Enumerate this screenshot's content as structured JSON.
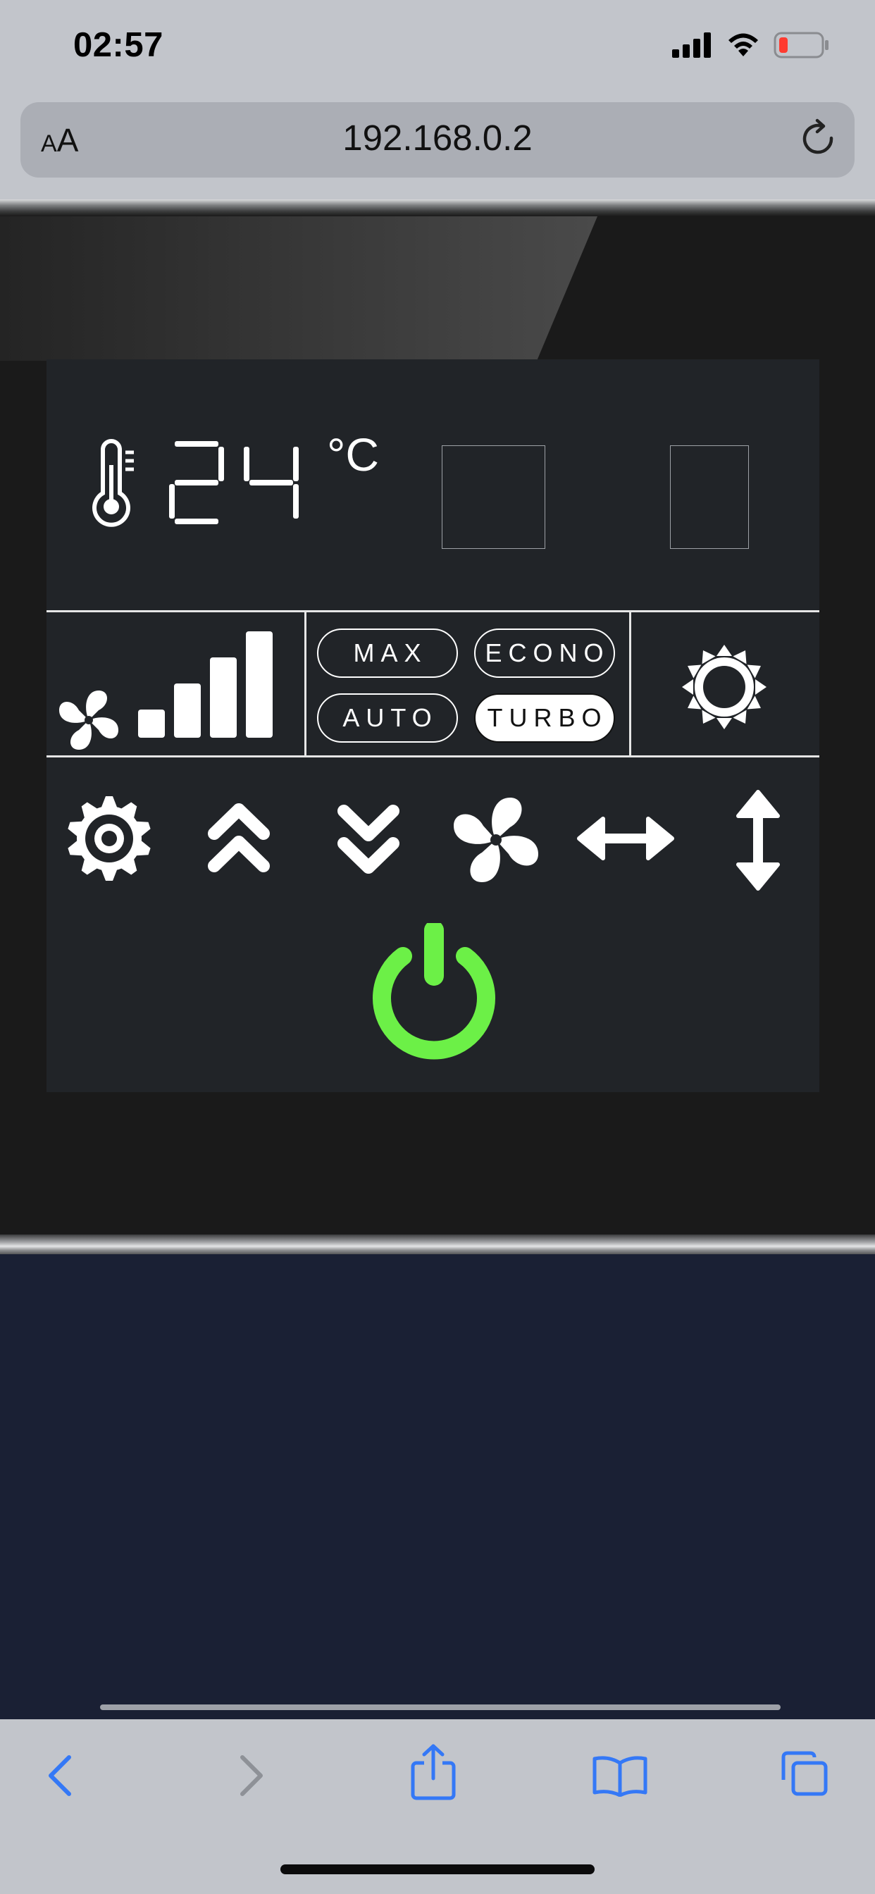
{
  "status_bar": {
    "time": "02:57",
    "icons": [
      "cellular-signal-icon",
      "wifi-icon",
      "battery-low-icon"
    ],
    "battery_color": "#ff3b30"
  },
  "browser": {
    "text_size_label_small": "A",
    "text_size_label_large": "A",
    "url": "192.168.0.2",
    "reload_icon": "reload-icon"
  },
  "thermostat": {
    "temperature": "24",
    "unit": "°C",
    "fan_speed_level": 4,
    "fan_speed_max": 4,
    "modes": [
      {
        "label": "MAX",
        "active": false
      },
      {
        "label": "ECONO",
        "active": false
      },
      {
        "label": "AUTO",
        "active": false
      },
      {
        "label": "TURBO",
        "active": true
      }
    ],
    "mode_indicator_icon": "sun-icon",
    "controls": [
      "settings-gear-icon",
      "temp-up-icon",
      "temp-down-icon",
      "fan-icon",
      "swing-horizontal-icon",
      "swing-vertical-icon"
    ],
    "power_icon": "power-icon",
    "power_color": "#6cf047"
  },
  "toolbar": {
    "buttons": [
      "back-icon",
      "forward-icon",
      "share-icon",
      "bookmarks-icon",
      "tabs-icon"
    ],
    "accent": "#3478f6"
  }
}
